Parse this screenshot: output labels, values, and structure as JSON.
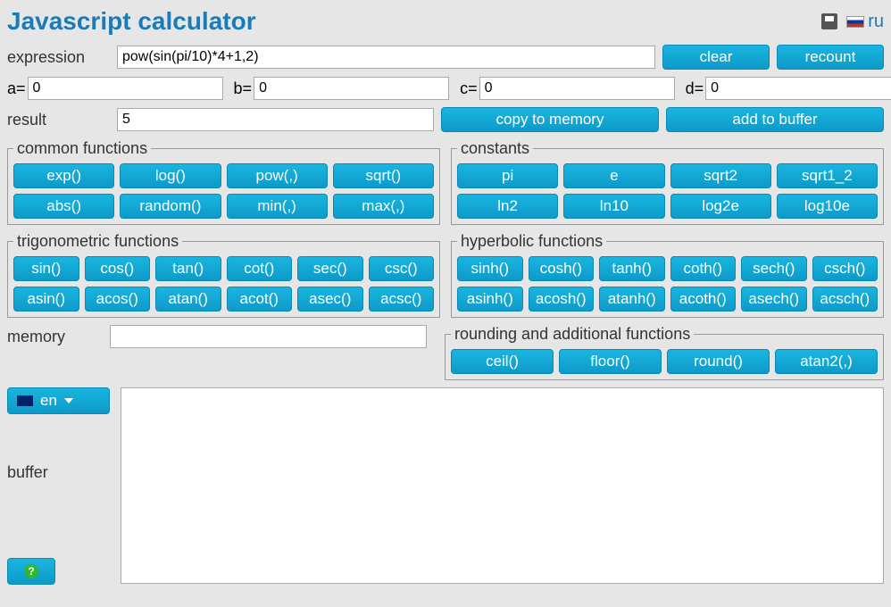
{
  "title": "Javascript calculator",
  "ru_label": "ru",
  "labels": {
    "expression": "expression",
    "result": "result",
    "memory": "memory",
    "buffer": "buffer"
  },
  "inputs": {
    "expression": "pow(sin(pi/10)*4+1,2)",
    "result": "5",
    "memory": "",
    "buffer": ""
  },
  "vars": {
    "a_label": "a=",
    "a_value": "0",
    "b_label": "b=",
    "b_value": "0",
    "c_label": "c=",
    "c_value": "0",
    "d_label": "d=",
    "d_value": "0"
  },
  "buttons": {
    "clear": "clear",
    "recount": "recount",
    "copy_to_memory": "copy to memory",
    "add_to_buffer": "add to buffer"
  },
  "lang": "en",
  "fieldsets": {
    "common": {
      "legend": "common functions",
      "items": [
        "exp()",
        "log()",
        "pow(,)",
        "sqrt()",
        "abs()",
        "random()",
        "min(,)",
        "max(,)"
      ]
    },
    "constants": {
      "legend": "constants",
      "items": [
        "pi",
        "e",
        "sqrt2",
        "sqrt1_2",
        "ln2",
        "ln10",
        "log2e",
        "log10e"
      ]
    },
    "trig": {
      "legend": "trigonometric functions",
      "items": [
        "sin()",
        "cos()",
        "tan()",
        "cot()",
        "sec()",
        "csc()",
        "asin()",
        "acos()",
        "atan()",
        "acot()",
        "asec()",
        "acsc()"
      ]
    },
    "hyper": {
      "legend": "hyperbolic functions",
      "items": [
        "sinh()",
        "cosh()",
        "tanh()",
        "coth()",
        "sech()",
        "csch()",
        "asinh()",
        "acosh()",
        "atanh()",
        "acoth()",
        "asech()",
        "acsch()"
      ]
    },
    "rounding": {
      "legend": "rounding and additional functions",
      "items": [
        "ceil()",
        "floor()",
        "round()",
        "atan2(,)"
      ]
    }
  }
}
